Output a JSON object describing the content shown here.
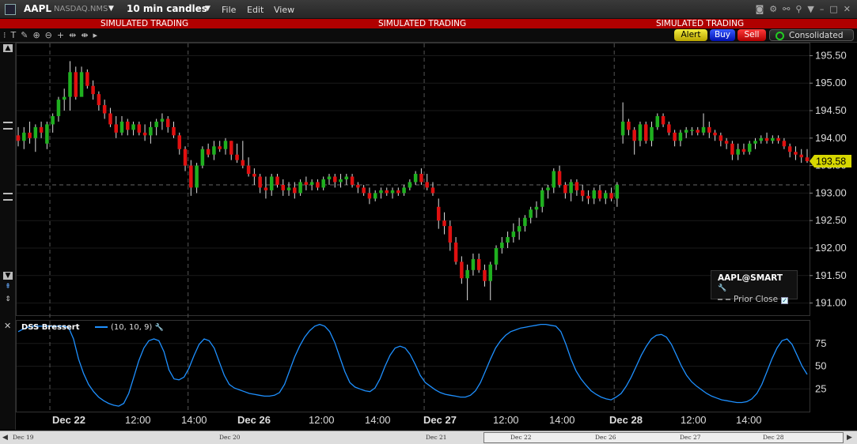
{
  "window": {
    "symbol": "AAPL",
    "exchange": "NASDAQ.NMS",
    "interval": "10 min candles",
    "menus": [
      "File",
      "Edit",
      "View"
    ]
  },
  "sim_banner": {
    "left": "SIMULATED TRADING",
    "center": "SIMULATED TRADING",
    "right": "SIMULATED TRADING"
  },
  "buttons": {
    "alert": "Alert",
    "buy": "Buy",
    "sell": "Sell",
    "consolidated": "Consolidated"
  },
  "legend": {
    "contract": "AAPL@SMART",
    "prior_close": "Prior Close"
  },
  "indicator": {
    "name": "DSS Bressert",
    "params": "(10, 10, 9)"
  },
  "current_price": "193.58",
  "colors": {
    "up": "#1fb01f",
    "down": "#e01010",
    "dss": "#1e90ff",
    "price_tag": "#d7d700",
    "sim_bar": "#b00000"
  },
  "price_axis_labels": [
    "195.50",
    "195.00",
    "194.50",
    "194.00",
    "193.50",
    "193.00",
    "192.50",
    "192.00",
    "191.50",
    "191.00"
  ],
  "dss_axis_labels": [
    "75",
    "50",
    "25"
  ],
  "time_labels": [
    {
      "text": "Dec 22",
      "bold": true
    },
    {
      "text": "12:00",
      "bold": false
    },
    {
      "text": "14:00",
      "bold": false
    },
    {
      "text": "Dec 26",
      "bold": true
    },
    {
      "text": "12:00",
      "bold": false
    },
    {
      "text": "14:00",
      "bold": false
    },
    {
      "text": "Dec 27",
      "bold": true
    },
    {
      "text": "12:00",
      "bold": false
    },
    {
      "text": "14:00",
      "bold": false
    },
    {
      "text": "Dec 28",
      "bold": true
    },
    {
      "text": "12:00",
      "bold": false
    },
    {
      "text": "14:00",
      "bold": false
    }
  ],
  "navigator_labels": [
    "Dec 19",
    "Dec 20",
    "Dec 21",
    "Dec 22",
    "Dec 26",
    "Dec 27",
    "Dec 28"
  ],
  "chart_data": {
    "type": "candlestick",
    "ylim": [
      190.85,
      195.65
    ],
    "prior_close": 193.15,
    "last_price": 193.58,
    "days": [
      "Dec 22",
      "Dec 26",
      "Dec 27",
      "Dec 28"
    ],
    "candles": [
      {
        "o": 194.05,
        "h": 194.2,
        "l": 193.85,
        "c": 193.95
      },
      {
        "o": 193.95,
        "h": 194.2,
        "l": 193.8,
        "c": 194.1
      },
      {
        "o": 194.1,
        "h": 194.3,
        "l": 193.9,
        "c": 194.0
      },
      {
        "o": 194.0,
        "h": 194.25,
        "l": 193.75,
        "c": 194.2
      },
      {
        "o": 194.2,
        "h": 194.3,
        "l": 194.0,
        "c": 194.1
      },
      {
        "o": 193.9,
        "h": 194.3,
        "l": 193.8,
        "c": 194.25
      },
      {
        "o": 194.25,
        "h": 194.45,
        "l": 194.1,
        "c": 194.4
      },
      {
        "o": 194.4,
        "h": 194.75,
        "l": 194.3,
        "c": 194.7
      },
      {
        "o": 194.7,
        "h": 194.9,
        "l": 194.5,
        "c": 194.75
      },
      {
        "o": 194.75,
        "h": 195.4,
        "l": 194.5,
        "c": 195.2
      },
      {
        "o": 195.2,
        "h": 195.3,
        "l": 194.7,
        "c": 194.75
      },
      {
        "o": 194.75,
        "h": 195.3,
        "l": 194.8,
        "c": 195.2
      },
      {
        "o": 195.2,
        "h": 195.25,
        "l": 194.9,
        "c": 194.95
      },
      {
        "o": 194.95,
        "h": 195.05,
        "l": 194.7,
        "c": 194.8
      },
      {
        "o": 194.8,
        "h": 194.85,
        "l": 194.5,
        "c": 194.6
      },
      {
        "o": 194.6,
        "h": 194.7,
        "l": 194.35,
        "c": 194.45
      },
      {
        "o": 194.45,
        "h": 194.55,
        "l": 194.2,
        "c": 194.25
      },
      {
        "o": 194.25,
        "h": 194.4,
        "l": 194.0,
        "c": 194.1
      },
      {
        "o": 194.1,
        "h": 194.4,
        "l": 194.05,
        "c": 194.3
      },
      {
        "o": 194.3,
        "h": 194.35,
        "l": 194.05,
        "c": 194.15
      },
      {
        "o": 194.15,
        "h": 194.3,
        "l": 194.05,
        "c": 194.25
      },
      {
        "o": 194.25,
        "h": 194.3,
        "l": 194.05,
        "c": 194.1
      },
      {
        "o": 194.1,
        "h": 194.25,
        "l": 193.95,
        "c": 194.05
      },
      {
        "o": 194.05,
        "h": 194.3,
        "l": 193.9,
        "c": 194.2
      },
      {
        "o": 194.2,
        "h": 194.35,
        "l": 194.05,
        "c": 194.3
      },
      {
        "o": 194.3,
        "h": 194.45,
        "l": 194.15,
        "c": 194.35
      },
      {
        "o": 194.35,
        "h": 194.4,
        "l": 194.1,
        "c": 194.2
      },
      {
        "o": 194.2,
        "h": 194.3,
        "l": 194.0,
        "c": 194.05
      },
      {
        "o": 194.05,
        "h": 194.1,
        "l": 193.7,
        "c": 193.8
      },
      {
        "o": 193.8,
        "h": 193.85,
        "l": 193.4,
        "c": 193.5
      },
      {
        "o": 193.5,
        "h": 193.6,
        "l": 192.95,
        "c": 193.1
      },
      {
        "o": 193.1,
        "h": 193.55,
        "l": 193.0,
        "c": 193.5
      },
      {
        "o": 193.5,
        "h": 193.85,
        "l": 193.45,
        "c": 193.8
      },
      {
        "o": 193.8,
        "h": 193.9,
        "l": 193.65,
        "c": 193.7
      },
      {
        "o": 193.7,
        "h": 193.95,
        "l": 193.6,
        "c": 193.85
      },
      {
        "o": 193.85,
        "h": 193.95,
        "l": 193.75,
        "c": 193.8
      },
      {
        "o": 193.8,
        "h": 194.0,
        "l": 193.7,
        "c": 193.95
      },
      {
        "o": 193.95,
        "h": 193.95,
        "l": 193.6,
        "c": 193.7
      },
      {
        "o": 193.7,
        "h": 193.9,
        "l": 193.55,
        "c": 193.6
      },
      {
        "o": 193.6,
        "h": 193.95,
        "l": 193.45,
        "c": 193.5
      },
      {
        "o": 193.5,
        "h": 193.65,
        "l": 193.3,
        "c": 193.35
      },
      {
        "o": 193.35,
        "h": 193.45,
        "l": 193.15,
        "c": 193.3
      },
      {
        "o": 193.3,
        "h": 193.35,
        "l": 193.0,
        "c": 193.1
      },
      {
        "o": 193.1,
        "h": 193.3,
        "l": 192.9,
        "c": 193.05
      },
      {
        "o": 193.05,
        "h": 193.35,
        "l": 192.95,
        "c": 193.3
      },
      {
        "o": 193.3,
        "h": 193.35,
        "l": 193.1,
        "c": 193.15
      },
      {
        "o": 193.15,
        "h": 193.25,
        "l": 192.95,
        "c": 193.05
      },
      {
        "o": 193.05,
        "h": 193.2,
        "l": 192.95,
        "c": 193.1
      },
      {
        "o": 193.1,
        "h": 193.2,
        "l": 192.9,
        "c": 193.0
      },
      {
        "o": 193.0,
        "h": 193.25,
        "l": 192.95,
        "c": 193.2
      },
      {
        "o": 193.2,
        "h": 193.3,
        "l": 193.05,
        "c": 193.15
      },
      {
        "o": 193.15,
        "h": 193.25,
        "l": 193.05,
        "c": 193.2
      },
      {
        "o": 193.2,
        "h": 193.25,
        "l": 193.05,
        "c": 193.1
      },
      {
        "o": 193.1,
        "h": 193.3,
        "l": 193.05,
        "c": 193.25
      },
      {
        "o": 193.25,
        "h": 193.35,
        "l": 193.15,
        "c": 193.3
      },
      {
        "o": 193.3,
        "h": 193.35,
        "l": 193.1,
        "c": 193.2
      },
      {
        "o": 193.2,
        "h": 193.35,
        "l": 193.1,
        "c": 193.25
      },
      {
        "o": 193.25,
        "h": 193.35,
        "l": 193.15,
        "c": 193.3
      },
      {
        "o": 193.3,
        "h": 193.35,
        "l": 193.1,
        "c": 193.15
      },
      {
        "o": 193.15,
        "h": 193.2,
        "l": 193.0,
        "c": 193.1
      },
      {
        "o": 193.1,
        "h": 193.15,
        "l": 192.95,
        "c": 193.0
      },
      {
        "o": 193.0,
        "h": 193.1,
        "l": 192.8,
        "c": 192.9
      },
      {
        "o": 192.9,
        "h": 193.05,
        "l": 192.85,
        "c": 193.0
      },
      {
        "o": 193.0,
        "h": 193.1,
        "l": 192.9,
        "c": 193.05
      },
      {
        "o": 193.05,
        "h": 193.1,
        "l": 192.95,
        "c": 193.0
      },
      {
        "o": 193.0,
        "h": 193.1,
        "l": 192.9,
        "c": 193.05
      },
      {
        "o": 193.05,
        "h": 193.1,
        "l": 192.95,
        "c": 193.0
      },
      {
        "o": 193.0,
        "h": 193.15,
        "l": 192.95,
        "c": 193.1
      },
      {
        "o": 193.1,
        "h": 193.25,
        "l": 193.05,
        "c": 193.2
      },
      {
        "o": 193.2,
        "h": 193.4,
        "l": 193.15,
        "c": 193.35
      },
      {
        "o": 193.35,
        "h": 193.45,
        "l": 193.15,
        "c": 193.2
      },
      {
        "o": 193.2,
        "h": 193.35,
        "l": 193.05,
        "c": 193.1
      },
      {
        "o": 193.1,
        "h": 193.2,
        "l": 192.95,
        "c": 193.0
      },
      {
        "o": 192.75,
        "h": 192.9,
        "l": 192.35,
        "c": 192.5
      },
      {
        "o": 192.5,
        "h": 192.65,
        "l": 192.25,
        "c": 192.4
      },
      {
        "o": 192.4,
        "h": 192.5,
        "l": 191.95,
        "c": 192.1
      },
      {
        "o": 192.1,
        "h": 192.2,
        "l": 191.7,
        "c": 191.75
      },
      {
        "o": 191.75,
        "h": 191.85,
        "l": 191.35,
        "c": 191.45
      },
      {
        "o": 191.45,
        "h": 191.7,
        "l": 191.05,
        "c": 191.6
      },
      {
        "o": 191.6,
        "h": 191.9,
        "l": 191.5,
        "c": 191.8
      },
      {
        "o": 191.8,
        "h": 191.9,
        "l": 191.55,
        "c": 191.6
      },
      {
        "o": 191.6,
        "h": 191.7,
        "l": 191.3,
        "c": 191.4
      },
      {
        "o": 191.4,
        "h": 191.75,
        "l": 191.05,
        "c": 191.7
      },
      {
        "o": 191.7,
        "h": 192.05,
        "l": 191.6,
        "c": 192.0
      },
      {
        "o": 192.0,
        "h": 192.2,
        "l": 191.9,
        "c": 192.1
      },
      {
        "o": 192.1,
        "h": 192.3,
        "l": 192.0,
        "c": 192.2
      },
      {
        "o": 192.2,
        "h": 192.45,
        "l": 192.1,
        "c": 192.3
      },
      {
        "o": 192.3,
        "h": 192.55,
        "l": 192.15,
        "c": 192.4
      },
      {
        "o": 192.4,
        "h": 192.6,
        "l": 192.3,
        "c": 192.55
      },
      {
        "o": 192.55,
        "h": 192.75,
        "l": 192.45,
        "c": 192.7
      },
      {
        "o": 192.7,
        "h": 192.85,
        "l": 192.55,
        "c": 192.75
      },
      {
        "o": 192.75,
        "h": 193.1,
        "l": 192.65,
        "c": 193.05
      },
      {
        "o": 193.05,
        "h": 193.15,
        "l": 192.9,
        "c": 193.1
      },
      {
        "o": 193.1,
        "h": 193.45,
        "l": 193.0,
        "c": 193.4
      },
      {
        "o": 193.4,
        "h": 193.5,
        "l": 193.1,
        "c": 193.15
      },
      {
        "o": 193.15,
        "h": 193.2,
        "l": 192.9,
        "c": 193.0
      },
      {
        "o": 193.0,
        "h": 193.25,
        "l": 192.85,
        "c": 193.2
      },
      {
        "o": 193.2,
        "h": 193.25,
        "l": 192.95,
        "c": 193.05
      },
      {
        "o": 193.05,
        "h": 193.15,
        "l": 192.85,
        "c": 192.95
      },
      {
        "o": 192.95,
        "h": 193.05,
        "l": 192.8,
        "c": 192.9
      },
      {
        "o": 192.9,
        "h": 193.1,
        "l": 192.8,
        "c": 193.05
      },
      {
        "o": 193.05,
        "h": 193.15,
        "l": 192.85,
        "c": 192.9
      },
      {
        "o": 192.9,
        "h": 193.05,
        "l": 192.8,
        "c": 193.0
      },
      {
        "o": 193.0,
        "h": 193.1,
        "l": 192.85,
        "c": 192.9
      },
      {
        "o": 192.9,
        "h": 193.2,
        "l": 192.75,
        "c": 193.15
      },
      {
        "o": 194.05,
        "h": 194.65,
        "l": 193.9,
        "c": 194.3
      },
      {
        "o": 194.3,
        "h": 194.35,
        "l": 194.05,
        "c": 194.15
      },
      {
        "o": 194.15,
        "h": 194.2,
        "l": 193.7,
        "c": 193.95
      },
      {
        "o": 193.95,
        "h": 194.3,
        "l": 193.85,
        "c": 194.25
      },
      {
        "o": 194.25,
        "h": 194.3,
        "l": 193.9,
        "c": 193.95
      },
      {
        "o": 193.95,
        "h": 194.3,
        "l": 193.85,
        "c": 194.2
      },
      {
        "o": 194.2,
        "h": 194.45,
        "l": 194.15,
        "c": 194.4
      },
      {
        "o": 194.4,
        "h": 194.45,
        "l": 194.2,
        "c": 194.25
      },
      {
        "o": 194.25,
        "h": 194.3,
        "l": 194.05,
        "c": 194.1
      },
      {
        "o": 194.1,
        "h": 194.15,
        "l": 193.85,
        "c": 193.95
      },
      {
        "o": 193.95,
        "h": 194.15,
        "l": 193.85,
        "c": 194.1
      },
      {
        "o": 194.1,
        "h": 194.2,
        "l": 194.0,
        "c": 194.15
      },
      {
        "o": 194.15,
        "h": 194.2,
        "l": 194.05,
        "c": 194.15
      },
      {
        "o": 194.15,
        "h": 194.2,
        "l": 194.05,
        "c": 194.1
      },
      {
        "o": 194.1,
        "h": 194.45,
        "l": 194.05,
        "c": 194.2
      },
      {
        "o": 194.2,
        "h": 194.3,
        "l": 194.0,
        "c": 194.1
      },
      {
        "o": 194.1,
        "h": 194.15,
        "l": 193.95,
        "c": 194.05
      },
      {
        "o": 194.05,
        "h": 194.1,
        "l": 193.85,
        "c": 193.95
      },
      {
        "o": 193.95,
        "h": 194.0,
        "l": 193.8,
        "c": 193.9
      },
      {
        "o": 193.9,
        "h": 193.95,
        "l": 193.6,
        "c": 193.7
      },
      {
        "o": 193.7,
        "h": 193.9,
        "l": 193.6,
        "c": 193.8
      },
      {
        "o": 193.8,
        "h": 193.9,
        "l": 193.7,
        "c": 193.75
      },
      {
        "o": 193.75,
        "h": 193.95,
        "l": 193.7,
        "c": 193.9
      },
      {
        "o": 193.9,
        "h": 194.0,
        "l": 193.8,
        "c": 193.95
      },
      {
        "o": 193.95,
        "h": 194.05,
        "l": 193.9,
        "c": 194.0
      },
      {
        "o": 194.0,
        "h": 194.1,
        "l": 193.9,
        "c": 193.95
      },
      {
        "o": 193.95,
        "h": 194.05,
        "l": 193.9,
        "c": 194.0
      },
      {
        "o": 194.0,
        "h": 194.05,
        "l": 193.9,
        "c": 193.95
      },
      {
        "o": 193.95,
        "h": 194.0,
        "l": 193.8,
        "c": 193.85
      },
      {
        "o": 193.85,
        "h": 193.9,
        "l": 193.65,
        "c": 193.75
      },
      {
        "o": 193.75,
        "h": 193.85,
        "l": 193.6,
        "c": 193.7
      },
      {
        "o": 193.7,
        "h": 193.8,
        "l": 193.55,
        "c": 193.65
      },
      {
        "o": 193.65,
        "h": 193.8,
        "l": 193.55,
        "c": 193.58
      }
    ],
    "dss": {
      "ylim": [
        0,
        100
      ],
      "values": [
        88,
        91,
        93,
        94,
        94,
        94,
        94,
        94,
        94,
        94,
        93,
        80,
        58,
        42,
        30,
        22,
        16,
        12,
        9,
        7,
        6,
        9,
        20,
        38,
        56,
        70,
        78,
        80,
        78,
        66,
        46,
        36,
        35,
        38,
        48,
        62,
        74,
        80,
        78,
        70,
        55,
        40,
        30,
        26,
        24,
        22,
        20,
        19,
        18,
        17,
        17,
        18,
        21,
        30,
        45,
        60,
        72,
        82,
        89,
        94,
        96,
        94,
        88,
        76,
        60,
        44,
        32,
        27,
        25,
        23,
        22,
        26,
        36,
        50,
        62,
        70,
        72,
        70,
        63,
        52,
        40,
        32,
        28,
        24,
        21,
        19,
        18,
        17,
        16,
        16,
        18,
        23,
        32,
        45,
        58,
        70,
        78,
        84,
        88,
        90,
        92,
        93,
        94,
        95,
        96,
        96,
        95,
        94,
        88,
        74,
        58,
        45,
        36,
        29,
        23,
        19,
        16,
        14,
        13,
        16,
        20,
        28,
        38,
        50,
        62,
        72,
        80,
        84,
        85,
        82,
        74,
        62,
        50,
        40,
        33,
        28,
        24,
        20,
        17,
        15,
        13,
        12,
        11,
        10,
        10,
        11,
        14,
        20,
        30,
        44,
        58,
        70,
        78,
        80,
        74,
        62,
        50,
        41
      ]
    }
  }
}
